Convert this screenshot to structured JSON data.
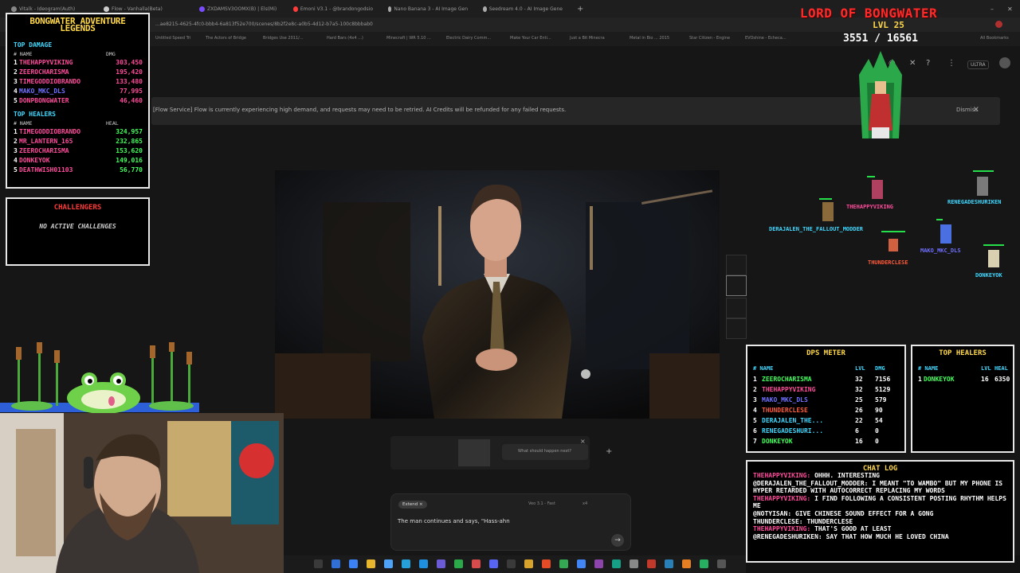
{
  "browser": {
    "tabs": [
      "Vitalk - Ideogram(Auth)",
      "Flow - Vanhalla(Beta)",
      "ZXDAMSV3OOMX(B) | Els(Mi)",
      "Emoni V3.1 - @brandongodsio",
      "Nano Banana 3 - AI Image Gen",
      "Seedream 4.0 - AI Image Gene"
    ],
    "url": "...ae8215-4625-4fc0-bbb4-6a813f52e700/scenes/8b2f2e8c-a0b5-4d12-b7a5-100c8bbbab0",
    "bookmarks": [
      "Untitled Speed Tri",
      "The Actors of Bridge",
      "Bridges Use 2011/...",
      "Hard Bars (4x4 ...)",
      "Minecraft | WR 5.10 ...",
      "Electric Dairy Comm...",
      "Make Your Car Enti...",
      "Just a Bit Minecra",
      "Metal in Bio ... 2015",
      "Star Citizen - Engine",
      "EVOshine - Echeca...",
      "All Bookmarks"
    ]
  },
  "app": {
    "banner_text": "[Flow Service] Flow is currently experiencing high demand, and requests may need to be retried. AI Credits will be refunded for any failed requests.",
    "dismiss_label": "Dismiss",
    "header_badge": "ULTRA",
    "timeline_prompt": "What should happen next?",
    "extend_label": "Extend",
    "model_label": "Veo 3.1 - Fast",
    "count_label": "x4",
    "prompt_text": "The man continues and says, \"Hass-ahn"
  },
  "legends": {
    "title_line1": "BONGWATER ADVENTURE",
    "title_line2": "LEGENDS",
    "damage_title": "TOP DAMAGE",
    "col_name": "# NAME",
    "col_dmg": "DMG",
    "damage": [
      {
        "rank": "1",
        "name": "THEHAPPYVIKING",
        "value": "303,450",
        "color": "#ff4b9b"
      },
      {
        "rank": "2",
        "name": "ZEEROCHARISMA",
        "value": "195,420",
        "color": "#ff4b9b"
      },
      {
        "rank": "3",
        "name": "TIMEGODDIOBRANDO",
        "value": "133,480",
        "color": "#ff4b9b"
      },
      {
        "rank": "4",
        "name": "MAKO_MKC_DLS",
        "value": "77,995",
        "color": "#6f6fff"
      },
      {
        "rank": "5",
        "name": "DONPBONGWATER",
        "value": "46,460",
        "color": "#ff4b9b"
      }
    ],
    "heal_title": "TOP HEALERS",
    "col_heal": "HEAL",
    "healers": [
      {
        "rank": "1",
        "name": "TIMEGODDIOBRANDO",
        "value": "324,957",
        "color": "#ff4b9b"
      },
      {
        "rank": "2",
        "name": "MR_LANTERN_165",
        "value": "232,865",
        "color": "#ff4b9b"
      },
      {
        "rank": "3",
        "name": "ZEEROCHARISMA",
        "value": "153,620",
        "color": "#ff4b9b"
      },
      {
        "rank": "4",
        "name": "DONKEYOK",
        "value": "149,016",
        "color": "#ff4b9b"
      },
      {
        "rank": "5",
        "name": "DEATHWISH01103",
        "value": "56,770",
        "color": "#ff4b9b"
      }
    ]
  },
  "challengers": {
    "title": "CHALLENGERS",
    "empty_text": "NO ACTIVE CHALLENGES"
  },
  "boss": {
    "title": "LORD OF BONGWATER",
    "level": "LVL 25",
    "hp": "3551 / 16561"
  },
  "party": [
    {
      "name": "THEHAPPYVIKING",
      "color": "#ff4b9b"
    },
    {
      "name": "RENEGADESHURIKEN",
      "color": "#3fd8ff"
    },
    {
      "name": "DERAJALEN_THE_FALLOUT_MODDER",
      "color": "#3fd8ff"
    },
    {
      "name": "MAKO_MKC_DLS",
      "color": "#6f6fff"
    },
    {
      "name": "THUNDERCLESE",
      "color": "#ff5a3a"
    },
    {
      "name": "DONKEYOK",
      "color": "#3fd8ff"
    }
  ],
  "dps_meter": {
    "title": "DPS METER",
    "col_name": "# NAME",
    "col_lvl": "LVL",
    "col_dmg": "DMG",
    "rows": [
      {
        "rank": "1",
        "name": "ZEEROCHARISMA",
        "lvl": "32",
        "dmg": "7156",
        "color": "#3fff5a"
      },
      {
        "rank": "2",
        "name": "THEHAPPYVIKING",
        "lvl": "32",
        "dmg": "5129",
        "color": "#ff4b9b"
      },
      {
        "rank": "3",
        "name": "MAKO_MKC_DLS",
        "lvl": "25",
        "dmg": "579",
        "color": "#6f6fff"
      },
      {
        "rank": "4",
        "name": "THUNDERCLESE",
        "lvl": "26",
        "dmg": "90",
        "color": "#ff5a3a"
      },
      {
        "rank": "5",
        "name": "DERAJALEN_THE...",
        "lvl": "22",
        "dmg": "54",
        "color": "#3fd8ff"
      },
      {
        "rank": "6",
        "name": "RENEGADESHURI...",
        "lvl": "6",
        "dmg": "0",
        "color": "#3fd8ff"
      },
      {
        "rank": "7",
        "name": "DONKEYOK",
        "lvl": "16",
        "dmg": "0",
        "color": "#3fff5a"
      }
    ]
  },
  "top_healers_live": {
    "title": "TOP HEALERS",
    "col_name": "# NAME",
    "col_lvl": "LVL",
    "col_heal": "HEAL",
    "rows": [
      {
        "rank": "1",
        "name": "DONKEYOK",
        "lvl": "16",
        "heal": "6350"
      }
    ]
  },
  "chat": {
    "title": "CHAT LOG",
    "lines": [
      {
        "user": "THEHAPPYVIKING:",
        "text": "OHHH. INTERESTING",
        "color": "#ff4b9b"
      },
      {
        "user": "@DERAJALEN_THE_FALLOUT_MODDER:",
        "text": "I MEANT \"TO WAMBO\" BUT MY PHONE IS HYPER RETARDED WITH AUTOCORRECT REPLACING MY WORDS",
        "color": "#ffffff"
      },
      {
        "user": "THEHAPPYVIKING:",
        "text": "I FIND FOLLOWING A CONSISTENT POSTING RHYTHM HELPS ME",
        "color": "#ff4b9b"
      },
      {
        "user": "@NOTYISAN:",
        "text": "GIVE CHINESE SOUND EFFECT FOR A GONG",
        "color": "#ffffff"
      },
      {
        "user": "THUNDERCLESE:",
        "text": "THUNDERCLESE",
        "color": "#ffffff"
      },
      {
        "user": "THEHAPPYVIKING:",
        "text": "THAT'S GOOD AT LEAST",
        "color": "#ff4b9b"
      },
      {
        "user": "@RENEGADESHURIKEN:",
        "text": "SAY THAT HOW MUCH HE LOVED CHINA",
        "color": "#ffffff"
      }
    ]
  }
}
